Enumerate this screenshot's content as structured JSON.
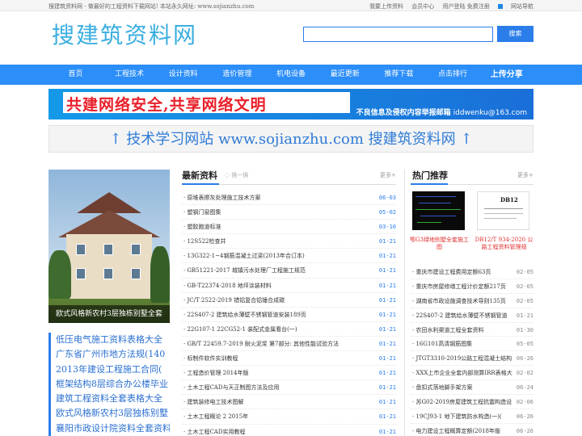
{
  "topbar": {
    "site_desc": "搜建筑资料网 - 做最好的工程资料下载网站! 本站永久网址: www.sojianzhu.com",
    "links": [
      "我要上传资料",
      "会员中心",
      "用户登陆 免费注册",
      "网站导航"
    ]
  },
  "header": {
    "logo": "搜建筑资料网",
    "search_placeholder": "",
    "search_button": "搜索"
  },
  "nav": {
    "items": [
      "首页",
      "工程技术",
      "设计资料",
      "造价管理",
      "机电设备",
      "最近更新",
      "推荐下载",
      "点击排行",
      "上传分享"
    ]
  },
  "banner": {
    "slogan": "共建网络安全,共享网络文明",
    "report_label": "不良信息及侵权内容举报邮箱",
    "report_email": "iddwenku@163.com"
  },
  "ad": {
    "text": "↑ 技术学习网站 www.sojianzhu.com 搜建筑资料网 ↑"
  },
  "feature": {
    "caption": "欧式风格新农村3层独栋别墅全套"
  },
  "left_list": [
    "低压电气施工资料表格大全",
    "广东省广州市地方法规(140",
    "2013年建设工程施工合同(",
    "框架结构8层综合办公楼毕业",
    "建筑工程资料全套表格大全",
    "欧式风格新农村3层独栋别墅",
    "襄阳市政设计院资料全套资料"
  ],
  "middle": {
    "title": "最新资料",
    "subtitle": "换一换",
    "more": "更多+",
    "rows": [
      {
        "title": "· 原堆表擦灰处理施工技术方案",
        "date": "06-03"
      },
      {
        "title": "· 塑钢门窗图集",
        "date": "05-02"
      },
      {
        "title": "· 塑胶跑道标准",
        "date": "03-10"
      },
      {
        "title": "· 12S522检查井",
        "date": "01-21"
      },
      {
        "title": "· 13G322-1~4钢筋混凝土过梁(2013年合订本)",
        "date": "01-21"
      },
      {
        "title": "· GB51221-2017 城镇污水处理厂工程施工规范",
        "date": "01-21"
      },
      {
        "title": "· GB-T22374-2018 地坪涂装材料",
        "date": "01-21"
      },
      {
        "title": "· JC/T 2522-2019 错铝复合铝锤合成碳",
        "date": "01-21"
      },
      {
        "title": "· 22S407-2 建筑给水薄壁不锈钢管道安装189页",
        "date": "01-21"
      },
      {
        "title": "· 22G107-1 22CG52-1 装配式金属看台(一)",
        "date": "01-21"
      },
      {
        "title": "· GB/T 22459.7-2019 耐火泥浆 第7部分: 其他性能试验方法",
        "date": "01-21"
      },
      {
        "title": "· 标制件软件实训教程",
        "date": "01-21"
      },
      {
        "title": "· 工程造价管理 2014年版",
        "date": "01-21"
      },
      {
        "title": "· 土木工程CAD与天正制图方法及应用",
        "date": "01-21"
      },
      {
        "title": "· 建筑装修电工技术图解",
        "date": "01-21"
      },
      {
        "title": "· 土木工程概论 2 2015年",
        "date": "01-21"
      },
      {
        "title": "· 土木工程CAD实用教程",
        "date": "01-21"
      }
    ]
  },
  "right": {
    "title": "热门推荐",
    "more": "更多+",
    "thumbs": [
      {
        "caption": "鄂G3绿地别墅全套施工图",
        "label": ""
      },
      {
        "caption": "DB12/T 934-2020 公路工程资料管理规",
        "label": "DB12"
      }
    ],
    "rows": [
      {
        "title": "· 重庆市建设工程费用定额63页",
        "date": "02-05"
      },
      {
        "title": "· 重庆市房屋修缮工程计价定额217页",
        "date": "02-05"
      },
      {
        "title": "· 湖南省市政设施调查技术导则135页",
        "date": "02-05"
      },
      {
        "title": "· 22S407-2 建筑给水薄壁不锈钢管道",
        "date": "01-21"
      },
      {
        "title": "· 农田水利渠道工程全套资料",
        "date": "01-30"
      },
      {
        "title": "· 16G101高清钢筋图集",
        "date": "05-05"
      },
      {
        "title": "· JTGT3310-2019公路工程混凝土结构",
        "date": "06-26"
      },
      {
        "title": "· XXX上市企业全套内部测算IRR表格大",
        "date": "02-02"
      },
      {
        "title": "· 盘扣式落地脚手架方案",
        "date": "06-24"
      },
      {
        "title": "· 苏G02-2019房屋建筑工程抗震构造设",
        "date": "02-06"
      },
      {
        "title": "· 19CJ93-1 地下建筑防水构造(一)(",
        "date": "06-26"
      },
      {
        "title": "· 电力建设工程概算定额(2018年版",
        "date": "06-26"
      }
    ]
  }
}
